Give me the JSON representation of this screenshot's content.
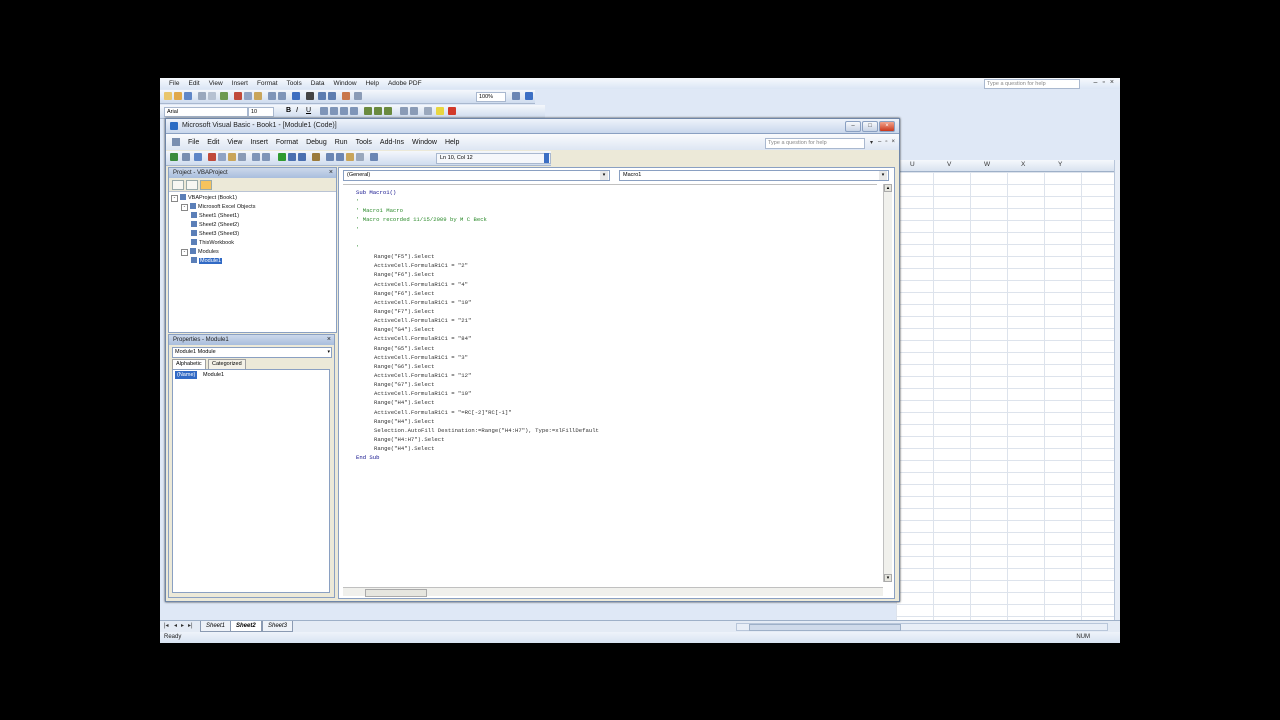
{
  "excel": {
    "menu": [
      "File",
      "Edit",
      "View",
      "Insert",
      "Format",
      "Tools",
      "Data",
      "Window",
      "Help",
      "Adobe PDF"
    ],
    "help_placeholder": "Type a question for help",
    "font_name": "Arial",
    "font_size": "10",
    "zoom": "100%",
    "columns": [
      "U",
      "V",
      "W",
      "X",
      "Y"
    ],
    "sheet_tabs": [
      "Sheet1",
      "Sheet2",
      "Sheet3"
    ],
    "active_sheet": "Sheet2",
    "status": "Ready",
    "num": "NUM"
  },
  "vbe": {
    "title": "Microsoft Visual Basic - Book1 - [Module1 (Code)]",
    "menu": [
      "File",
      "Edit",
      "View",
      "Insert",
      "Format",
      "Debug",
      "Run",
      "Tools",
      "Add-Ins",
      "Window",
      "Help"
    ],
    "help_placeholder": "Type a question for help",
    "position": "Ln 10, Col 12",
    "project": {
      "title": "Project - VBAProject",
      "tree": [
        {
          "label": "VBAProject (Book1)",
          "indent": 0,
          "toggle": "-"
        },
        {
          "label": "Microsoft Excel Objects",
          "indent": 1,
          "toggle": "-"
        },
        {
          "label": "Sheet1 (Sheet1)",
          "indent": 2,
          "toggle": ""
        },
        {
          "label": "Sheet2 (Sheet2)",
          "indent": 2,
          "toggle": ""
        },
        {
          "label": "Sheet3 (Sheet3)",
          "indent": 2,
          "toggle": ""
        },
        {
          "label": "ThisWorkbook",
          "indent": 2,
          "toggle": ""
        },
        {
          "label": "Modules",
          "indent": 1,
          "toggle": "-"
        },
        {
          "label": "Module1",
          "indent": 2,
          "toggle": "",
          "selected": true
        }
      ]
    },
    "properties": {
      "title": "Properties - Module1",
      "object": "Module1 Module",
      "tabs": [
        "Alphabetic",
        "Categorized"
      ],
      "prop_name": "(Name)",
      "prop_value": "Module1"
    },
    "code": {
      "object_combo": "(General)",
      "proc_combo": "Macro1",
      "lines": [
        {
          "t": "Sub Macro1()",
          "c": "kw",
          "i": 0
        },
        {
          "t": "'",
          "c": "cm",
          "i": 0
        },
        {
          "t": "' Macro1 Macro",
          "c": "cm",
          "i": 0
        },
        {
          "t": "' Macro recorded 11/15/2009 by M C Beck",
          "c": "cm",
          "i": 0
        },
        {
          "t": "'",
          "c": "cm",
          "i": 0
        },
        {
          "t": "",
          "c": "tx",
          "i": 0
        },
        {
          "t": "'",
          "c": "cm",
          "i": 0
        },
        {
          "t": "Range(\"F5\").Select",
          "c": "tx",
          "i": 1
        },
        {
          "t": "ActiveCell.FormulaR1C1 = \"2\"",
          "c": "tx",
          "i": 1
        },
        {
          "t": "Range(\"F6\").Select",
          "c": "tx",
          "i": 1
        },
        {
          "t": "ActiveCell.FormulaR1C1 = \"4\"",
          "c": "tx",
          "i": 1
        },
        {
          "t": "Range(\"F6\").Select",
          "c": "tx",
          "i": 1
        },
        {
          "t": "ActiveCell.FormulaR1C1 = \"10\"",
          "c": "tx",
          "i": 1
        },
        {
          "t": "Range(\"F7\").Select",
          "c": "tx",
          "i": 1
        },
        {
          "t": "ActiveCell.FormulaR1C1 = \"21\"",
          "c": "tx",
          "i": 1
        },
        {
          "t": "Range(\"G4\").Select",
          "c": "tx",
          "i": 1
        },
        {
          "t": "ActiveCell.FormulaR1C1 = \"84\"",
          "c": "tx",
          "i": 1
        },
        {
          "t": "Range(\"G5\").Select",
          "c": "tx",
          "i": 1
        },
        {
          "t": "ActiveCell.FormulaR1C1 = \"3\"",
          "c": "tx",
          "i": 1
        },
        {
          "t": "Range(\"G6\").Select",
          "c": "tx",
          "i": 1
        },
        {
          "t": "ActiveCell.FormulaR1C1 = \"12\"",
          "c": "tx",
          "i": 1
        },
        {
          "t": "Range(\"G7\").Select",
          "c": "tx",
          "i": 1
        },
        {
          "t": "ActiveCell.FormulaR1C1 = \"10\"",
          "c": "tx",
          "i": 1
        },
        {
          "t": "Range(\"H4\").Select",
          "c": "tx",
          "i": 1
        },
        {
          "t": "ActiveCell.FormulaR1C1 = \"=RC[-2]*RC[-1]\"",
          "c": "tx",
          "i": 1
        },
        {
          "t": "Range(\"H4\").Select",
          "c": "tx",
          "i": 1
        },
        {
          "t": "Selection.AutoFill Destination:=Range(\"H4:H7\"), Type:=xlFillDefault",
          "c": "tx",
          "i": 1
        },
        {
          "t": "Range(\"H4:H7\").Select",
          "c": "tx",
          "i": 1
        },
        {
          "t": "Range(\"H4\").Select",
          "c": "tx",
          "i": 1
        },
        {
          "t": "End Sub",
          "c": "kw",
          "i": 0
        }
      ]
    }
  },
  "colors": {
    "accent": "#316ac5",
    "keyword": "#10108c",
    "comment": "#2a8a2a",
    "excel_bg": "#dfe8f6"
  }
}
